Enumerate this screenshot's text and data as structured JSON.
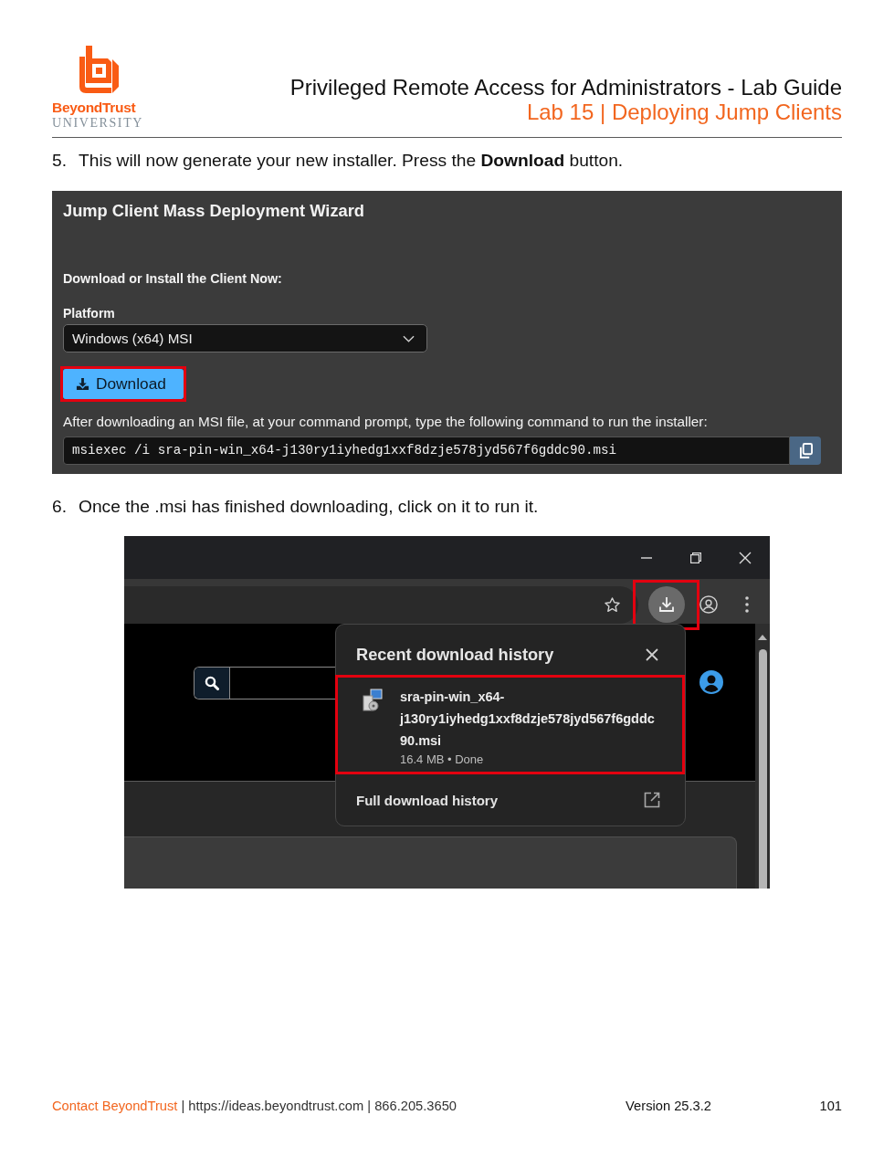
{
  "header": {
    "logo": {
      "brand": "BeyondTrust",
      "tagline": "UNIVERSITY"
    },
    "title": "Privileged Remote Access for Administrators - Lab Guide",
    "subtitle": "Lab 15 | Deploying Jump Clients"
  },
  "steps": [
    {
      "number": "5.",
      "text": "This will now generate your new installer. Press the **Download** button.",
      "figure": {
        "kind": "wizard",
        "title": "Jump Client Mass Deployment Wizard",
        "section_label": "Download or Install the Client Now:",
        "platform": {
          "label": "Platform",
          "value": "Windows (x64) MSI"
        },
        "download_button": {
          "label": "Download",
          "highlighted": true
        },
        "instruction": "After downloading an MSI file, at your command prompt, type the following command to run the installer:",
        "command": "msiexec /i sra-pin-win_x64-j130ry1iyhedg1xxf8dzje578jyd567f6gddc90.msi"
      }
    },
    {
      "number": "6.",
      "text": "Once the .msi has finished downloading, click on it to run it.",
      "figure": {
        "kind": "browser",
        "download_button": {
          "highlighted": true
        },
        "downloads_panel": {
          "title": "Recent download history",
          "items": [
            {
              "filename": "sra-pin-win_x64-j130ry1iyhedg1xxf8dzje578jyd567f6gddc90.msi",
              "status": "16.4 MB • Done",
              "highlighted": true
            }
          ],
          "footer_link": "Full download history"
        }
      }
    }
  ],
  "footer": {
    "contact": "Contact BeyondTrust",
    "details": "| https://ideas.beyondtrust.com | 866.205.3650",
    "version": "Version 25.3.2",
    "page": "101"
  }
}
